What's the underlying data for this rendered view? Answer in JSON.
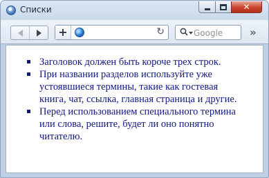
{
  "window": {
    "title": "Списки",
    "controls": {
      "minimize": "minimize",
      "maximize": "maximize",
      "close": "✕"
    }
  },
  "toolbar": {
    "add_label": "+",
    "reload_glyph": "↻",
    "search_placeholder": "Google",
    "overflow_glyph": "»"
  },
  "content": {
    "list": [
      "Заголовок должен быть короче трех строк.",
      "При названии разделов используйте уже устоявшиеся термины, такие как гостевая книга, чат, ссылка, главная страница и другие.",
      "Перед использованием специального термина или слова, решите, будет ли оно понятно читателю."
    ]
  },
  "colors": {
    "text": "#0f1780",
    "close_button": "#c7432a",
    "chrome": "#c9d8ea"
  },
  "icons": [
    "app-icon",
    "back-arrow-icon",
    "forward-arrow-icon",
    "add-icon",
    "globe-icon",
    "reload-icon",
    "search-icon",
    "overflow-chevron-icon"
  ]
}
